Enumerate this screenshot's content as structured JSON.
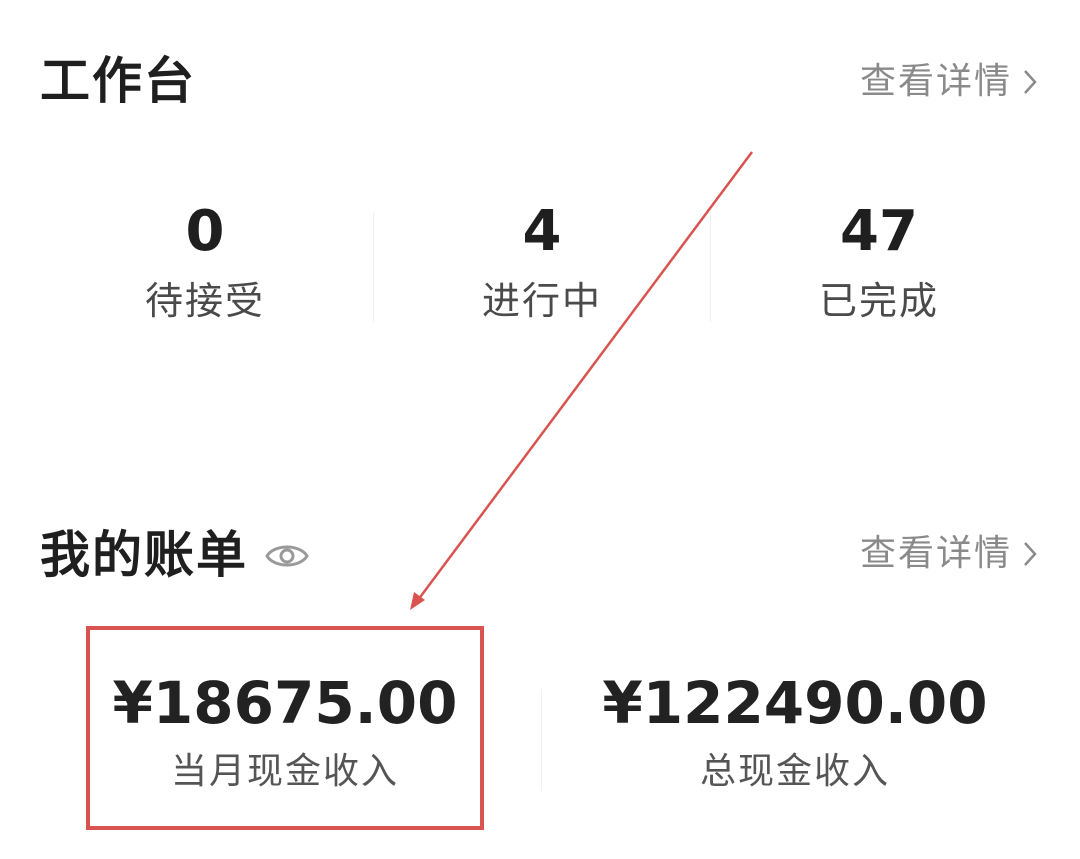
{
  "workbench": {
    "title": "工作台",
    "details_label": "查看详情",
    "stats": [
      {
        "value": "0",
        "label": "待接受"
      },
      {
        "value": "4",
        "label": "进行中"
      },
      {
        "value": "47",
        "label": "已完成"
      }
    ]
  },
  "bill": {
    "title": "我的账单",
    "details_label": "查看详情",
    "items": [
      {
        "value": "¥18675.00",
        "label": "当月现金收入"
      },
      {
        "value": "¥122490.00",
        "label": "总现金收入"
      }
    ]
  },
  "icons": {
    "visibility": "eye-icon",
    "details": "chevron-right-icon"
  },
  "colors": {
    "annotation": "#d9534f",
    "muted_text": "#8a8a8a"
  }
}
